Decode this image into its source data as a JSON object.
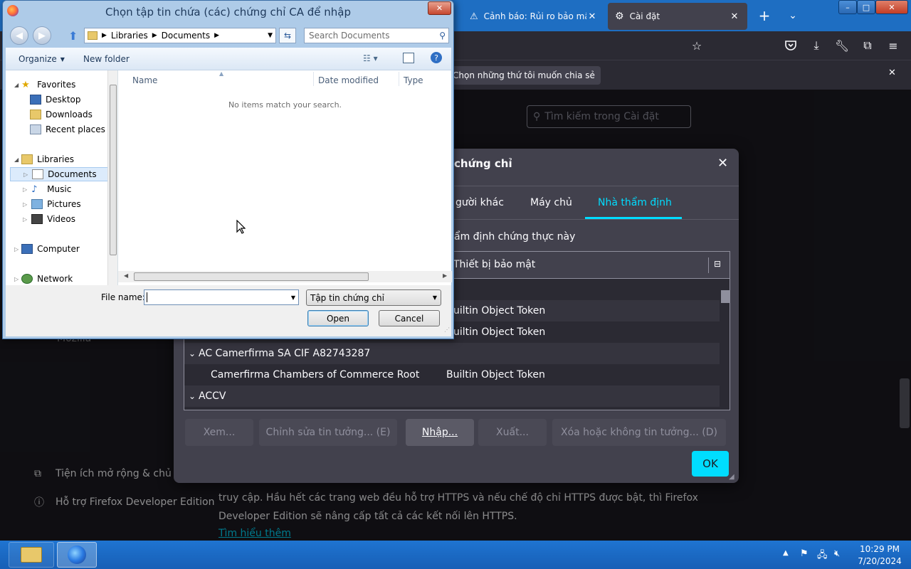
{
  "browser": {
    "tabs": [
      {
        "title": "Cảnh báo: Rủi ro bảo mật t"
      },
      {
        "title": "Cài đặt"
      }
    ],
    "new_tab_symbol": "+",
    "notification": "Chọn những thứ tôi muốn chia sẻ",
    "settings_search_placeholder": "Tìm kiếm trong Cài đặt",
    "sidebar": {
      "extensions": "Tiện ích mở rộng & chủ đề",
      "support": "Hỗ trợ Firefox Developer Edition",
      "mozilla": "Mozilla"
    },
    "body_text": {
      "line1": "truy cập. Hầu hết các trang web đều hỗ trợ HTTPS và nếu chế độ chỉ HTTPS được bật, thì Firefox",
      "line2": "Developer Edition sẽ nâng cấp tất cả các kết nối lên HTTPS.",
      "link": "Tìm hiểu thêm"
    }
  },
  "cert_manager": {
    "title": "chứng chỉ",
    "tabs": {
      "people": "gười khác",
      "servers": "Máy chủ",
      "authorities": "Nhà thẩm định"
    },
    "description": "ẩm định chứng thực này",
    "column_device": "Thiết bị bảo mật",
    "rows": [
      {
        "name": "",
        "device": "uiltin Object Token",
        "type": "cert"
      },
      {
        "name": "",
        "device": "uiltin Object Token",
        "type": "cert"
      },
      {
        "name": "AC Camerfirma SA CIF A82743287",
        "device": "",
        "type": "group"
      },
      {
        "name": "Camerfirma Chambers of Commerce Root",
        "device": "Builtin Object Token",
        "type": "cert"
      },
      {
        "name": "ACCV",
        "device": "",
        "type": "group"
      }
    ],
    "buttons": {
      "view": "Xem...",
      "edit": "Chỉnh sửa tin tưởng... (E)",
      "import": "Nhập...",
      "export": "Xuất...",
      "delete": "Xóa hoặc không tin tưởng... (D)",
      "ok": "OK"
    }
  },
  "file_dialog": {
    "title": "Chọn tập tin chứa (các) chứng chỉ CA để nhập",
    "breadcrumb": [
      "Libraries",
      "Documents"
    ],
    "search_placeholder": "Search Documents",
    "organize": "Organize",
    "new_folder": "New folder",
    "nav": {
      "favorites": "Favorites",
      "desktop": "Desktop",
      "downloads": "Downloads",
      "recent": "Recent places",
      "libraries": "Libraries",
      "documents": "Documents",
      "music": "Music",
      "pictures": "Pictures",
      "videos": "Videos",
      "computer": "Computer",
      "network": "Network"
    },
    "columns": {
      "name": "Name",
      "date": "Date modified",
      "type": "Type"
    },
    "empty_message": "No items match your search.",
    "file_name_label": "File name:",
    "file_name_value": "",
    "file_type": "Tập tin chứng chỉ",
    "open": "Open",
    "cancel": "Cancel"
  },
  "taskbar": {
    "time": "10:29 PM",
    "date": "7/20/2024"
  },
  "colors": {
    "accent": "#00ddff",
    "modal_bg": "#42414d",
    "dialog_frame": "#aecbe8",
    "taskbar": "#1f74d1"
  }
}
